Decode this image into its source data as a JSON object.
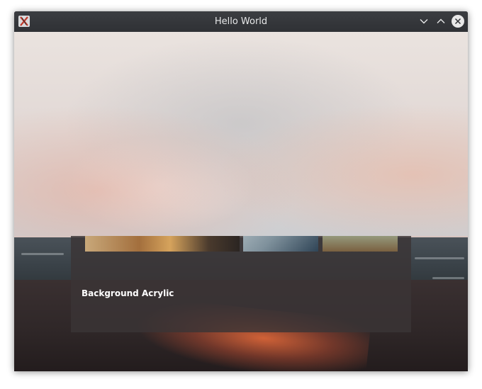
{
  "window": {
    "title": "Hello World"
  },
  "card": {
    "label": "Background Acrylic"
  },
  "icons": {
    "app": "app-logo-icon",
    "minimize": "chevron-down-icon",
    "maximize": "chevron-up-icon",
    "close": "close-icon"
  },
  "colors": {
    "titlebar": "#33363a",
    "title_text": "#e6e7e8",
    "card_label": "#ffffff",
    "sunset_glow": "#ec6c3a"
  }
}
